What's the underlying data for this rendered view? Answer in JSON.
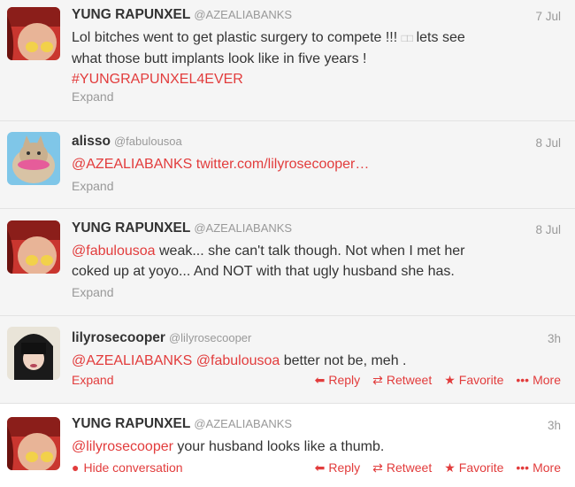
{
  "tweets": [
    {
      "name": "YUNG RAPUNXEL",
      "handle": "@AZEALIABANKS",
      "time": "7 Jul",
      "line1": "Lol bitches went to get plastic surgery to compete !!!",
      "emoji": "□□",
      "line1_end": "lets see",
      "line2": "what those butt implants look like in five years !",
      "hashtag": "#YUNGRAPUNXEL4EVER",
      "expand": "Expand"
    },
    {
      "name": "alisso",
      "handle": "@fabulousoa",
      "time": "8 Jul",
      "mention": "@AZEALIABANKS",
      "link": "twitter.com/lilyrosecooper…",
      "expand": "Expand"
    },
    {
      "name": "YUNG RAPUNXEL",
      "handle": "@AZEALIABANKS",
      "time": "8 Jul",
      "mention": "@fabulousoa",
      "line1_rest": "weak... she can't talk though. Not when I met her",
      "line2": "coked up at yoyo... And NOT with that ugly husband she has.",
      "expand": "Expand"
    },
    {
      "name": "lilyrosecooper",
      "handle": "@lilyrosecooper",
      "time": "3h",
      "mention1": "@AZEALIABANKS",
      "mention2": "@fabulousoa",
      "rest": "better not be, meh .",
      "expand": "Expand",
      "reply": "Reply",
      "retweet": "Retweet",
      "favorite": "Favorite",
      "more": "More"
    },
    {
      "name": "YUNG RAPUNXEL",
      "handle": "@AZEALIABANKS",
      "time": "3h",
      "mention": "@lilyrosecooper",
      "rest": "your husband looks like a thumb.",
      "hide": "Hide conversation",
      "reply": "Reply",
      "retweet": "Retweet",
      "favorite": "Favorite",
      "more": "More"
    }
  ],
  "colors": {
    "accent": "#e23c3c",
    "muted": "#999999",
    "text": "#333333"
  },
  "icons": {
    "reply": "reply-arrow-icon",
    "retweet": "retweet-icon",
    "favorite": "star-icon",
    "more": "ellipsis-icon",
    "hide": "speech-bubble-icon"
  }
}
